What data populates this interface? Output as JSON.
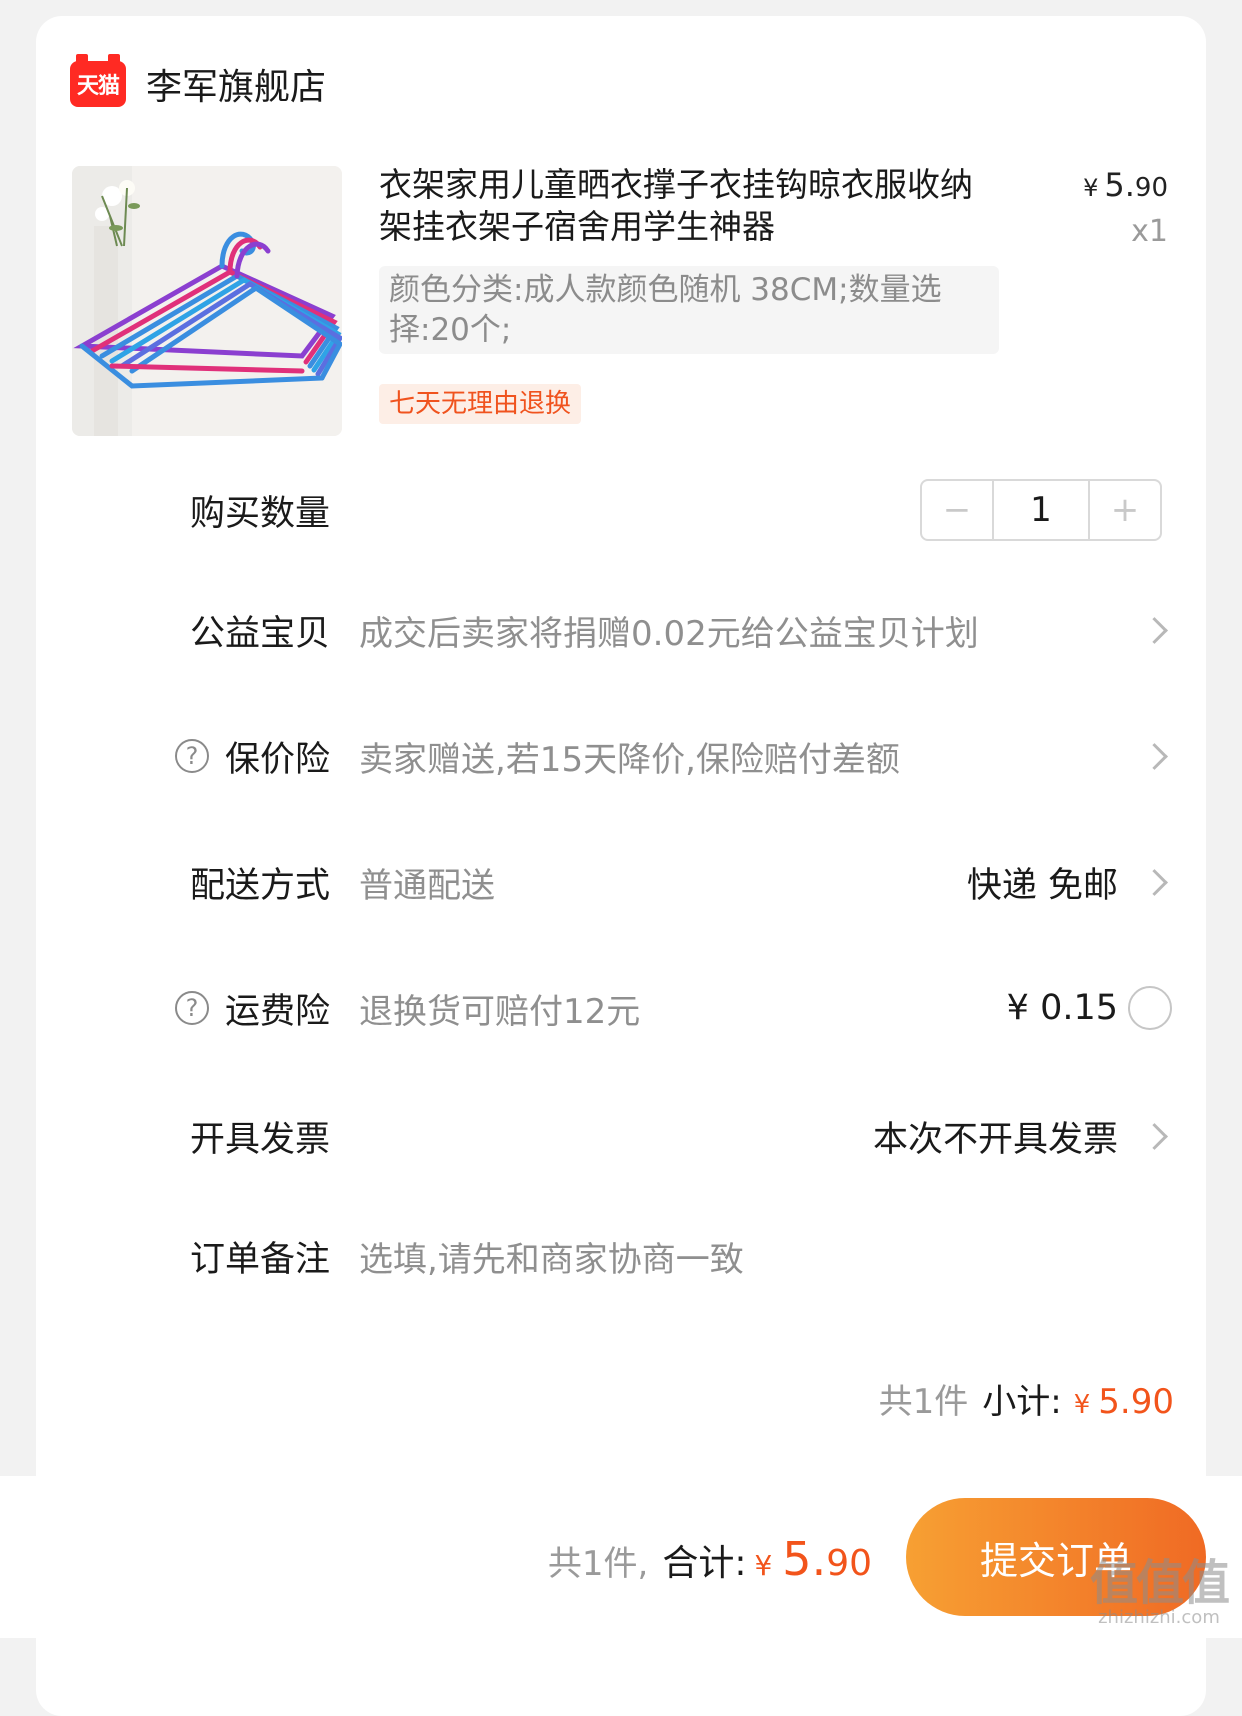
{
  "shop": {
    "badge": "天猫",
    "name": "李军旗舰店"
  },
  "product": {
    "title": "衣架家用儿童晒衣撑子衣挂钩晾衣服收纳架挂衣架子宿舍用学生神器",
    "price_currency": "¥",
    "price_int": "5.",
    "price_dec": "90",
    "quantity_text": "x1",
    "sku": "颜色分类:成人款颜色随机 38CM;数量选择:20个;",
    "return_tag": "七天无理由退换",
    "image_colors": [
      "#3a8ee0",
      "#e0307a",
      "#8b3fd0",
      "#2fa3e6"
    ]
  },
  "rows": {
    "quantity": {
      "label": "购买数量",
      "minus": "−",
      "value": "1",
      "plus": "+"
    },
    "charity": {
      "label": "公益宝贝",
      "desc": "成交后卖家将捐赠0.02元给公益宝贝计划"
    },
    "price_protect": {
      "label": "保价险",
      "help": "?",
      "desc": "卖家赠送,若15天降价,保险赔付差额"
    },
    "delivery": {
      "label": "配送方式",
      "desc": "普通配送",
      "value": "快递 免邮"
    },
    "shipping_insurance": {
      "label": "运费险",
      "help": "?",
      "desc": "退换货可赔付12元",
      "value": "¥ 0.15"
    },
    "invoice": {
      "label": "开具发票",
      "value": "本次不开具发票"
    },
    "note": {
      "label": "订单备注",
      "placeholder": "选填,请先和商家协商一致"
    }
  },
  "subtotal": {
    "count": "共1件",
    "label": "小计:",
    "currency": "¥",
    "amount": "5.90"
  },
  "bottom": {
    "count": "共1件,",
    "label": "合计:",
    "currency": "¥",
    "amount_int": "5.",
    "amount_dec": "90",
    "submit_label": "提交订单"
  },
  "watermark": {
    "text": "值值值",
    "url": "zhizhizhi.com"
  },
  "colors": {
    "accent": "#f2541b",
    "tmall_red": "#ff2a23",
    "button_start": "#f7a033",
    "button_end": "#f06a24"
  }
}
